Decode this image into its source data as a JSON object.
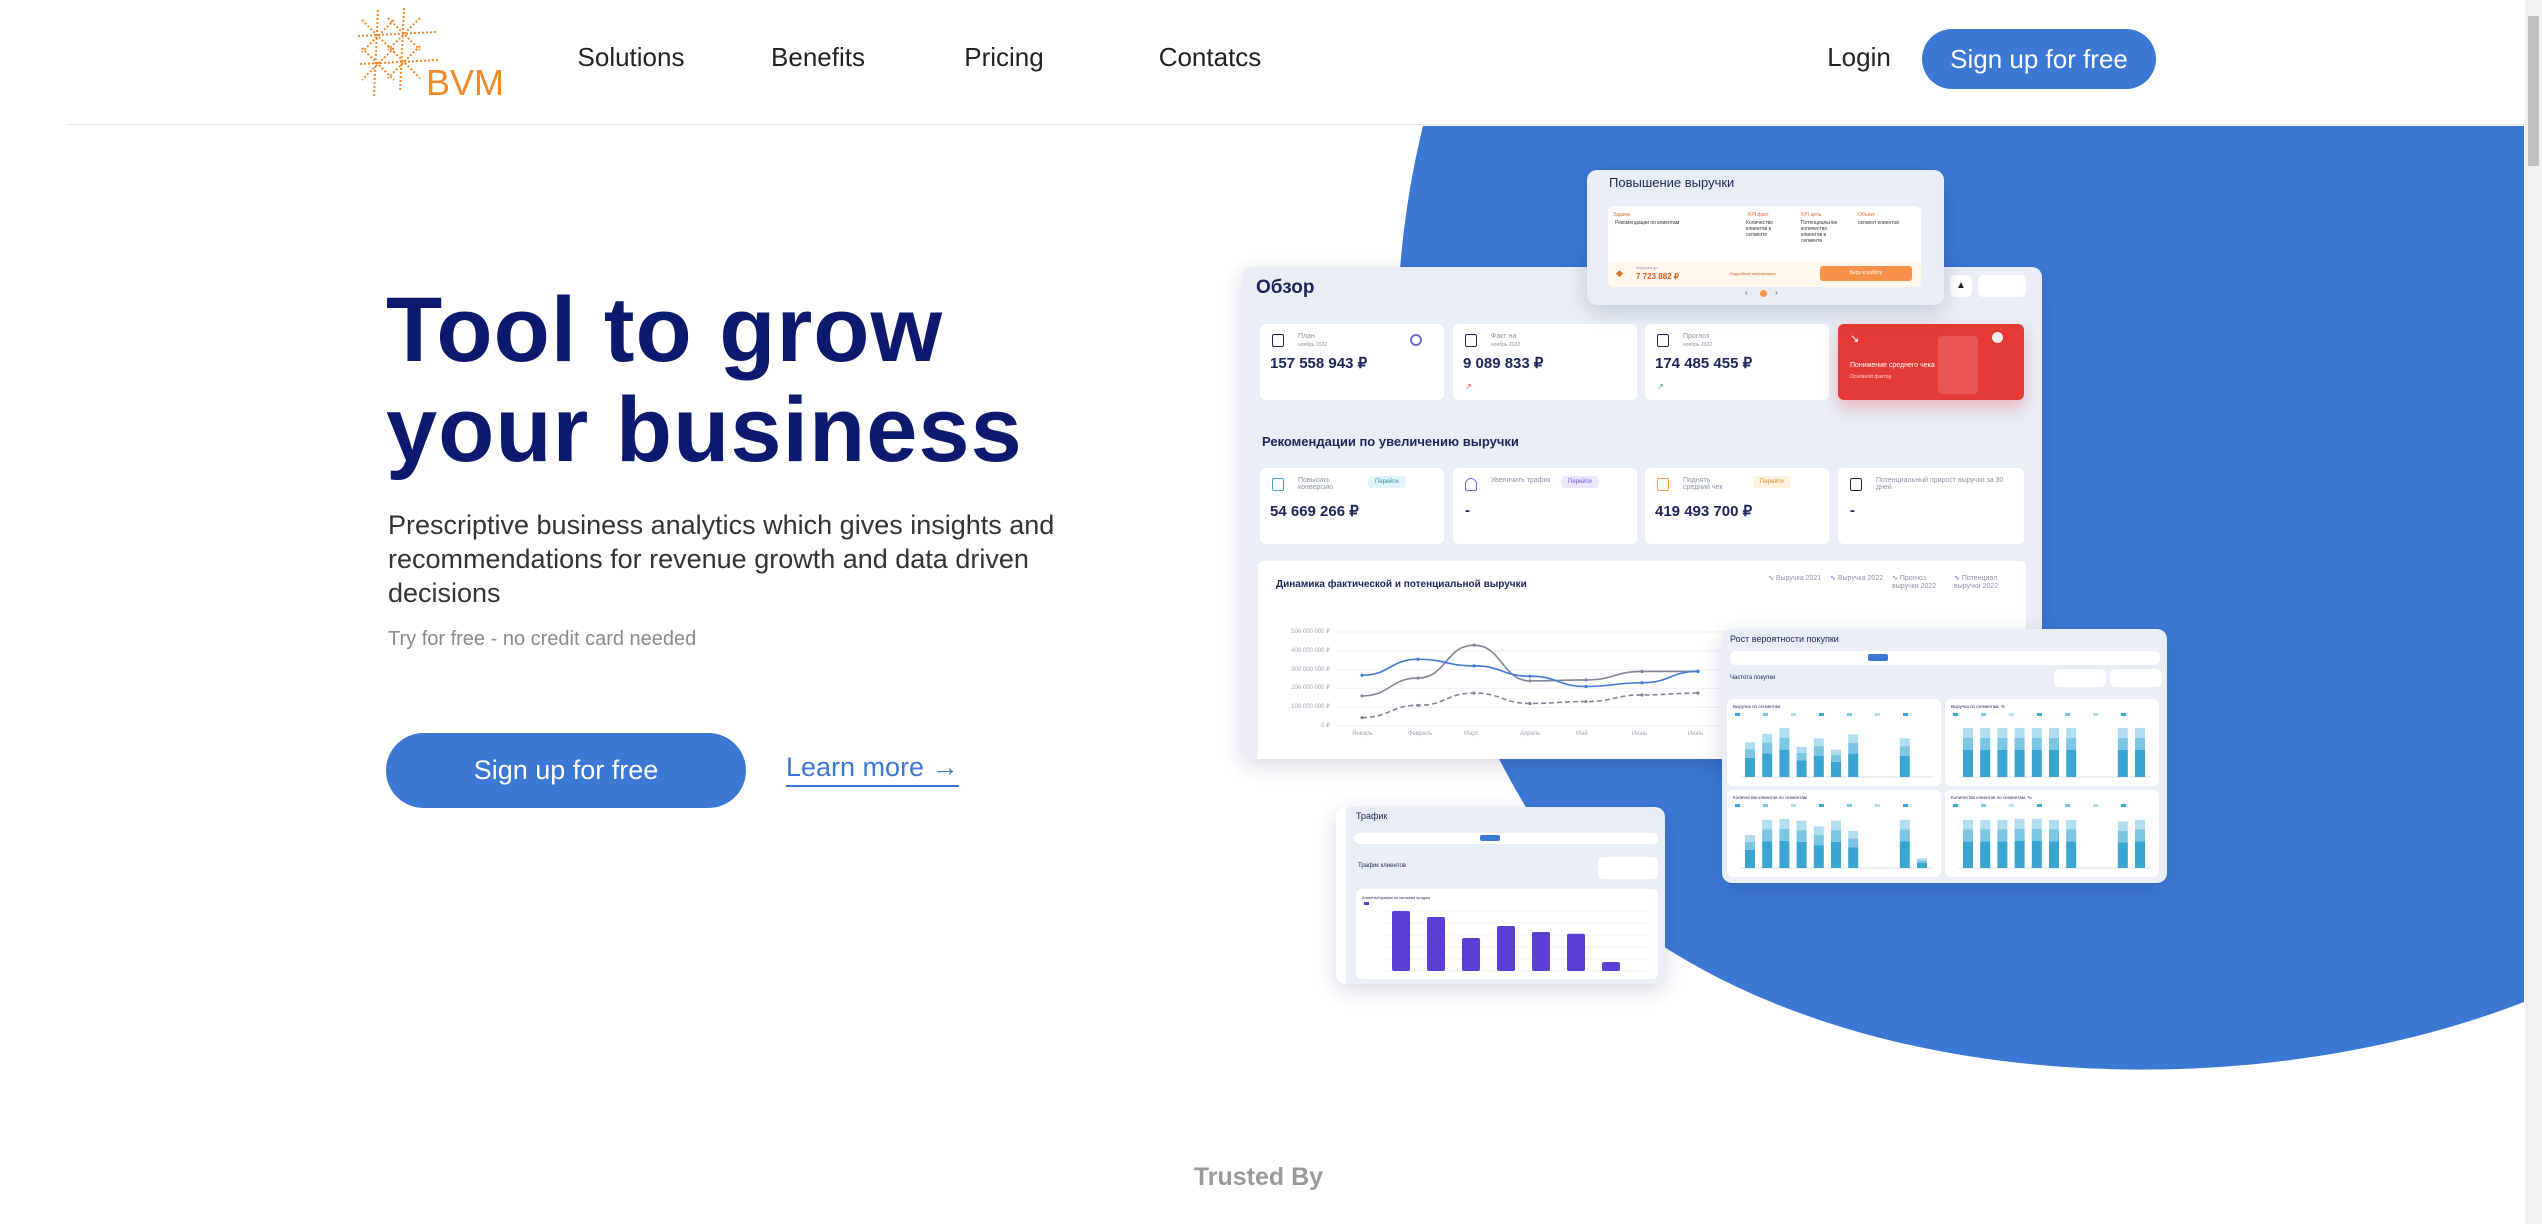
{
  "colors": {
    "brand": "#3b78d4",
    "navy": "#0b1a6e",
    "logo": "#f0892a",
    "danger": "#e53935",
    "bar_dark": "#3aa5d0",
    "bar_mid": "#7cc6e4",
    "bar_light": "#b0def0",
    "traffic_bar": "#5b3fd4"
  },
  "logo": {
    "text": "BVM",
    "icon": "bvm-starburst-logo"
  },
  "nav": {
    "items": [
      {
        "label": "Solutions"
      },
      {
        "label": "Benefits"
      },
      {
        "label": "Pricing"
      },
      {
        "label": "Contatcs"
      }
    ],
    "login": "Login",
    "signup": "Sign up for free"
  },
  "hero": {
    "title_line1": "Tool to grow",
    "title_line2": "your business",
    "description": "Prescriptive business analytics which gives insights and recommendations for revenue growth and data driven decisions",
    "note": "Try for free - no credit card needed",
    "signup": "Sign up for free",
    "learn_more": "Learn more →"
  },
  "trusted": {
    "title": "Trusted By"
  },
  "mockup": {
    "overview": {
      "title": "Обзор",
      "kpis": [
        {
          "label": "План",
          "period": "ноябрь 2022",
          "value": "157 558 943 ₽"
        },
        {
          "label": "Факт на",
          "period": "ноябрь 2022",
          "value": "9 089 833 ₽"
        },
        {
          "label": "Прогноз",
          "period": "ноябрь 2022",
          "value": "174 485 455 ₽"
        }
      ],
      "alert": {
        "title": "Понижение среднего чека",
        "subtitle": "Основной фактор"
      },
      "rec_title": "Рекомендации по увеличению выручки",
      "recs": [
        {
          "label": "Повысить конверсию",
          "action": "Перейти",
          "value": "54 669 266 ₽"
        },
        {
          "label": "Увеличить трафик",
          "action": "Перейти",
          "value": "-"
        },
        {
          "label": "Поднять средний чек",
          "action": "Перейти",
          "value": "419 493 700 ₽"
        },
        {
          "label": "Потенциальный прирост выручки за 30 дней",
          "value": "-"
        }
      ],
      "chart": {
        "title": "Динамика фактической и потенциальной выручки",
        "type": "line",
        "categories": [
          "Январь",
          "Февраль",
          "Март",
          "Апрель",
          "Май",
          "Июнь",
          "Июль"
        ],
        "yticks": [
          "500 000 000 ₽",
          "400 000 000 ₽",
          "300 000 000 ₽",
          "200 000 000 ₽",
          "100 000 000 ₽",
          "0 ₽"
        ],
        "ylim": [
          0,
          500000000
        ],
        "series": [
          {
            "name": "Выручка 2021",
            "color": "#7d8595",
            "dashed": false,
            "values": [
              160000000,
              255000000,
              430000000,
              240000000,
              245000000,
              290000000,
              290000000
            ]
          },
          {
            "name": "Выручка 2022",
            "color": "#3f7ad0",
            "dashed": false,
            "values": [
              270000000,
              355000000,
              320000000,
              265000000,
              210000000,
              230000000,
              290000000
            ]
          },
          {
            "name": "Прогноз выручки 2022",
            "color": "#7d8595",
            "dashed": true,
            "values": [
              45000000,
              110000000,
              175000000,
              120000000,
              130000000,
              165000000,
              175000000
            ]
          },
          {
            "name": "Потенциал выручки 2022",
            "color": "#3f7ad0",
            "dashed": false,
            "values": []
          }
        ]
      }
    },
    "revenue_card": {
      "title": "Повышение выручки",
      "task_label": "Задача",
      "task": "Рекомендации по клиентам",
      "kpi_fact_label": "KPI факт",
      "kpi_fact": "Количество клиентов в сегменте",
      "kpi_goal_label": "KPI цель",
      "kpi_goal": "Потенциальное количество клиентов в сегменте",
      "object_label": "Объект",
      "object": "сегмент клиентов",
      "revenue_label": "Выручка до",
      "revenue": "7 723 882 ₽",
      "details": "Подробная информация",
      "take": "Беру в работу"
    },
    "purchase": {
      "title": "Рост вероятности покупки",
      "subtitle": "Частота покупки",
      "charts": [
        {
          "title": "Выручка по сегментам",
          "values": [
            5.3,
            6.6,
            7.5,
            4.6,
            5.9,
            4.2,
            6.5,
            null,
            null,
            5.9,
            null
          ]
        },
        {
          "title": "Выручка по сегментам, %",
          "values": [
            100,
            100,
            100,
            100,
            100,
            100,
            100,
            null,
            null,
            100,
            100
          ]
        },
        {
          "title": "Количество клиентов по сегментам",
          "values": [
            75,
            110,
            112,
            108,
            95,
            108,
            85,
            null,
            null,
            110,
            22
          ]
        },
        {
          "title": "Количество клиентов по сегментам, %",
          "values": [
            98,
            98,
            98,
            100,
            100,
            98,
            98,
            null,
            null,
            95,
            98
          ]
        }
      ]
    },
    "traffic": {
      "title": "Трафик",
      "subtitle": "Трафик клиентов",
      "chart_title": "Клиенты/трафик по каналам продаж",
      "values": [
        100,
        90,
        55,
        75,
        65,
        62,
        15
      ]
    }
  }
}
